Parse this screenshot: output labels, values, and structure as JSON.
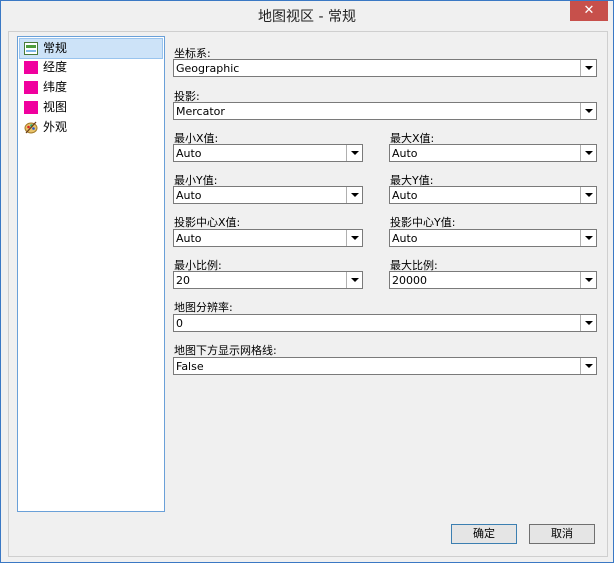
{
  "window": {
    "title": "地图视区 - 常规",
    "close_glyph": "✕"
  },
  "nav": {
    "items": [
      {
        "label": "常规",
        "icon": "general-icon",
        "selected": true
      },
      {
        "label": "经度",
        "icon": "pink-square-icon"
      },
      {
        "label": "纬度",
        "icon": "pink-square-icon"
      },
      {
        "label": "视图",
        "icon": "pink-square-icon"
      },
      {
        "label": "外观",
        "icon": "palette-icon"
      }
    ]
  },
  "form": {
    "coord_label": "坐标系:",
    "coord_value": "Geographic",
    "proj_label": "投影:",
    "proj_value": "Mercator",
    "minx_label": "最小X值:",
    "minx_value": "Auto",
    "maxx_label": "最大X值:",
    "maxx_value": "Auto",
    "miny_label": "最小Y值:",
    "miny_value": "Auto",
    "maxy_label": "最大Y值:",
    "maxy_value": "Auto",
    "pcx_label": "投影中心X值:",
    "pcx_value": "Auto",
    "pcy_label": "投影中心Y值:",
    "pcy_value": "Auto",
    "minscale_label": "最小比例:",
    "minscale_value": "20",
    "maxscale_label": "最大比例:",
    "maxscale_value": "20000",
    "res_label": "地图分辨率:",
    "res_value": "0",
    "grid_label": "地图下方显示网格线:",
    "grid_value": "False"
  },
  "buttons": {
    "ok": "确定",
    "cancel": "取消"
  },
  "colors": {
    "accent": "#3a78c4",
    "nav_selected": "#cde3f8",
    "pink": "#f0009e"
  }
}
